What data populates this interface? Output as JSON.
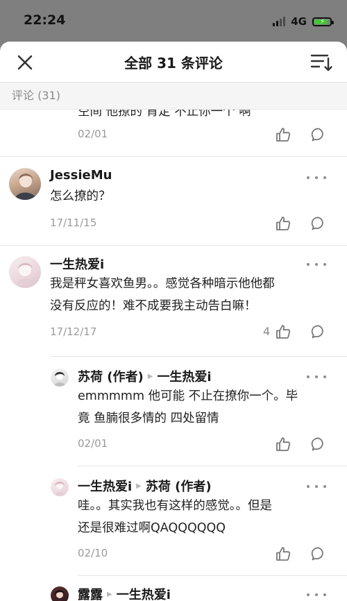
{
  "status": {
    "time": "22:24",
    "network": "4G"
  },
  "header": {
    "title": "全部 31 条评论"
  },
  "section": {
    "label": "评论 (31)"
  },
  "partial": {
    "text": "空间 他撩的 肯定 不止你一个 啊",
    "date": "02/01"
  },
  "comments": [
    {
      "name": "JessieMu",
      "text": "怎么撩的？",
      "date": "17/11/15"
    },
    {
      "name": "一生热爱i",
      "text_line1": "我是秤女喜欢鱼男。。感觉各种暗示他他都",
      "text_line2": "没有反应的！难不成要我主动告白嘛！",
      "date": "17/12/17",
      "likes": "4"
    }
  ],
  "replies": [
    {
      "author": "苏荷 (作者)",
      "to": "一生热爱i",
      "text_line1": "emmmmm 他可能 不止在撩你一个。毕",
      "text_line2": "竟 鱼腩很多情的 四处留情",
      "date": "02/01"
    },
    {
      "author": "一生热爱i",
      "to": "苏荷 (作者)",
      "text_line1": "哇。。其实我也有这样的感觉。。但是",
      "text_line2": "还是很难过啊QAQQQQQQ",
      "date": "02/10"
    },
    {
      "author": "露露",
      "to": "一生热爱i"
    }
  ]
}
